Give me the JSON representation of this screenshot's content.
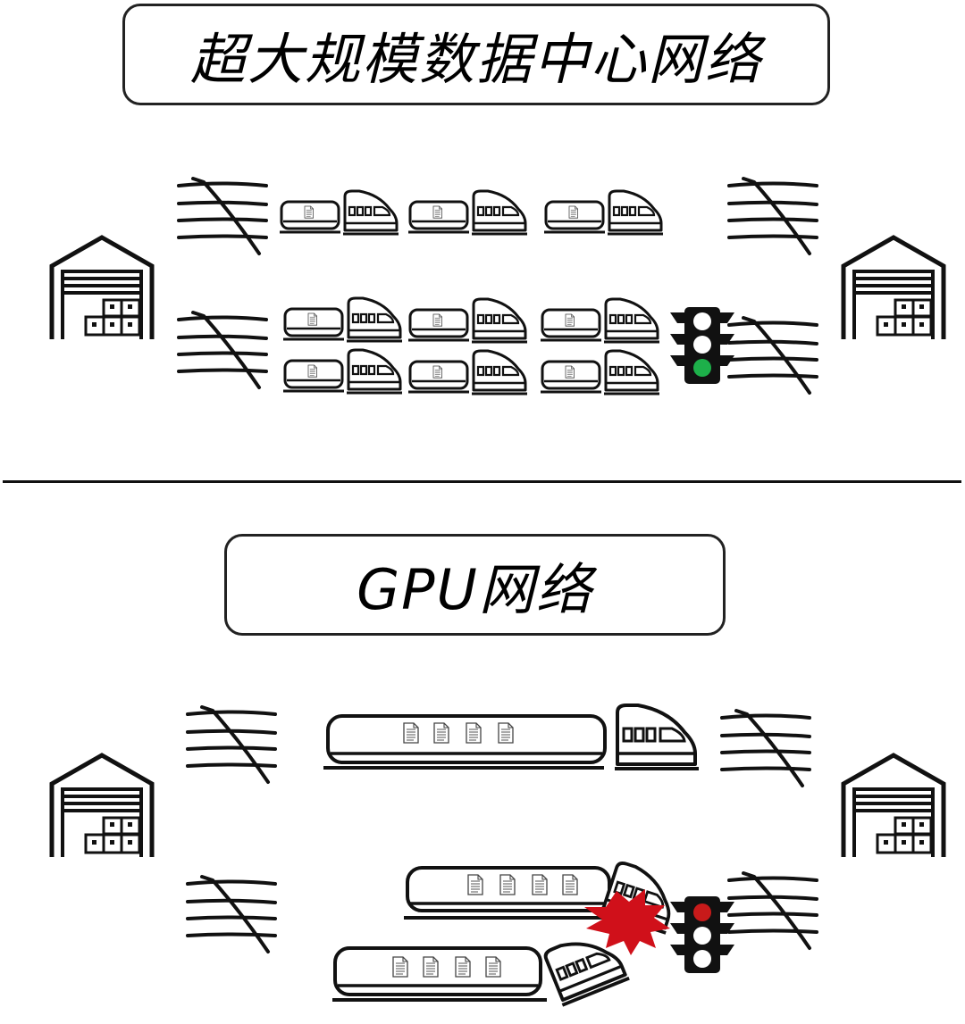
{
  "sections": {
    "hyperscale": {
      "title": "超大规模数据中心网络",
      "signal_state": "green"
    },
    "gpu": {
      "title": "GPU网络",
      "signal_state": "red",
      "event": "collision"
    }
  },
  "colors": {
    "stroke": "#111111",
    "signal_green": "#1db04a",
    "signal_red": "#c81a1a",
    "signal_off": "#ffffff",
    "crash": "#d0101a"
  },
  "icons": [
    "warehouse-icon",
    "rail-track-icon",
    "train-icon",
    "document-icon",
    "traffic-light-icon",
    "crash-burst-icon"
  ]
}
